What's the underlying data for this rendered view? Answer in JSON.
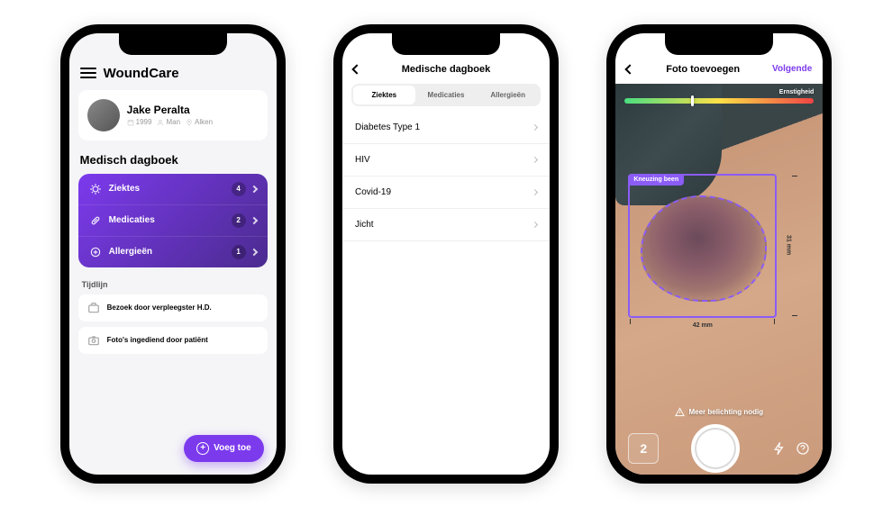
{
  "screen1": {
    "app_title": "WoundCare",
    "patient": {
      "name": "Jake Peralta",
      "year": "1999",
      "gender": "Man",
      "location": "Alken"
    },
    "section_title": "Medisch dagboek",
    "diary": [
      {
        "label": "Ziektes",
        "count": "4"
      },
      {
        "label": "Medicaties",
        "count": "2"
      },
      {
        "label": "Allergieën",
        "count": "1"
      }
    ],
    "timeline_title": "Tijdlijn",
    "timeline": [
      {
        "label": "Bezoek door verpleegster H.D.",
        "date": " "
      },
      {
        "label": "Foto's ingediend door patiënt",
        "date": " "
      }
    ],
    "fab_label": "Voeg toe"
  },
  "screen2": {
    "title": "Medische dagboek",
    "tabs": [
      {
        "label": "Ziektes",
        "active": true
      },
      {
        "label": "Medicaties",
        "active": false
      },
      {
        "label": "Allergieën",
        "active": false
      }
    ],
    "items": [
      "Diabetes Type 1",
      "HIV",
      "Covid-19",
      "Jicht"
    ]
  },
  "screen3": {
    "title": "Foto toevoegen",
    "next": "Volgende",
    "severity_label": "Ernstigheid",
    "annotation": "Kneuzing been",
    "width": "42 mm",
    "height": "31 mm",
    "warning": "Meer belichting nodig",
    "photo_count": "2"
  }
}
